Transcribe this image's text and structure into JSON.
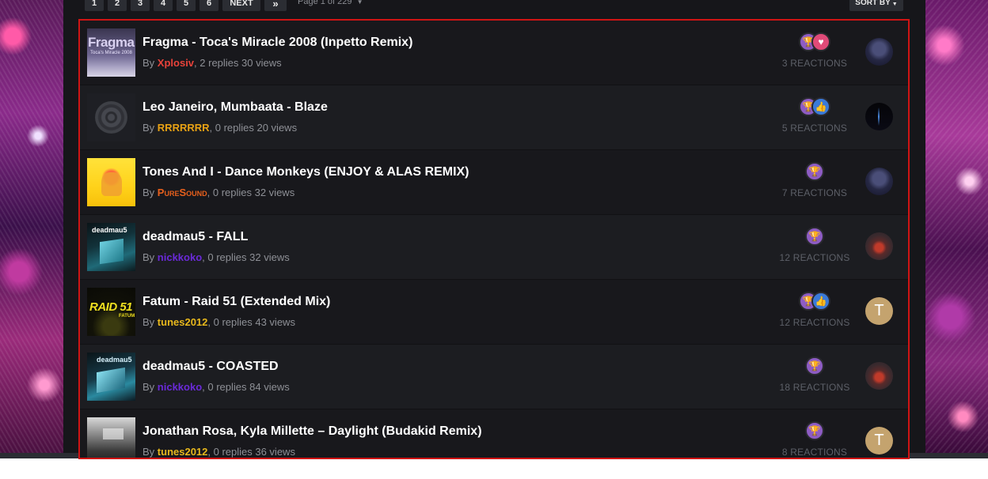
{
  "pagination": {
    "pages": [
      "1",
      "2",
      "3",
      "4",
      "5",
      "6"
    ],
    "next_label": "NEXT",
    "last_symbol": "»",
    "page_of": "Page 1 of 229",
    "sort_by": "SORT BY"
  },
  "topics": [
    {
      "title": "Fragma - Toca's Miracle 2008 (Inpetto Remix)",
      "by": "By",
      "author": "Xplosiv",
      "author_color": "#e8423a",
      "stats": ", 2 replies 30 views",
      "reaction_icons": [
        "trophy-icon",
        "heart-icon"
      ],
      "reactions": "3 REACTIONS",
      "thumb_text": "Fragma",
      "thumb_sub": "Toca's Miracle 2008",
      "avatar_letter": ""
    },
    {
      "title": "Leo Janeiro, Mumbaata - Blaze",
      "by": "By",
      "author": "RRRRRRR",
      "author_color": "#e8a214",
      "stats": ", 0 replies 20 views",
      "reaction_icons": [
        "trophy-icon",
        "like-icon"
      ],
      "reactions": "5 REACTIONS",
      "thumb_text": "",
      "thumb_sub": "",
      "avatar_letter": ""
    },
    {
      "title": "Tones And I - Dance Monkeys (ENJOY & ALAS REMIX)",
      "by": "By",
      "author": "PureSound",
      "author_color": "#e8601c",
      "stats": ", 0 replies 32 views",
      "reaction_icons": [
        "trophy-icon"
      ],
      "reactions": "7 REACTIONS",
      "thumb_text": "",
      "thumb_sub": "",
      "avatar_letter": ""
    },
    {
      "title": "deadmau5 - FALL",
      "by": "By",
      "author": "nickkoko",
      "author_color": "#6a2ad8",
      "stats": ", 0 replies 32 views",
      "reaction_icons": [
        "trophy-icon"
      ],
      "reactions": "12 REACTIONS",
      "thumb_text": "deadmau5",
      "thumb_sub": "",
      "avatar_letter": ""
    },
    {
      "title": "Fatum - Raid 51 (Extended Mix)",
      "by": "By",
      "author": "tunes2012",
      "author_color": "#e8b81c",
      "stats": ", 0 replies 43 views",
      "reaction_icons": [
        "trophy-icon",
        "like-icon"
      ],
      "reactions": "12 REACTIONS",
      "thumb_text": "RAID 51",
      "thumb_sub": "FATUM",
      "avatar_letter": "T"
    },
    {
      "title": "deadmau5 - COASTED",
      "by": "By",
      "author": "nickkoko",
      "author_color": "#6a2ad8",
      "stats": ", 0 replies 84 views",
      "reaction_icons": [
        "trophy-icon"
      ],
      "reactions": "18 REACTIONS",
      "thumb_text": "deadmau5",
      "thumb_sub": "",
      "avatar_letter": ""
    },
    {
      "title": "Jonathan Rosa, Kyla Millette – Daylight (Budakid Remix)",
      "by": "By",
      "author": "tunes2012",
      "author_color": "#e8b81c",
      "stats": ", 0 replies 36 views",
      "reaction_icons": [
        "trophy-icon"
      ],
      "reactions": "8 REACTIONS",
      "thumb_text": "",
      "thumb_sub": "",
      "avatar_letter": "T"
    }
  ]
}
